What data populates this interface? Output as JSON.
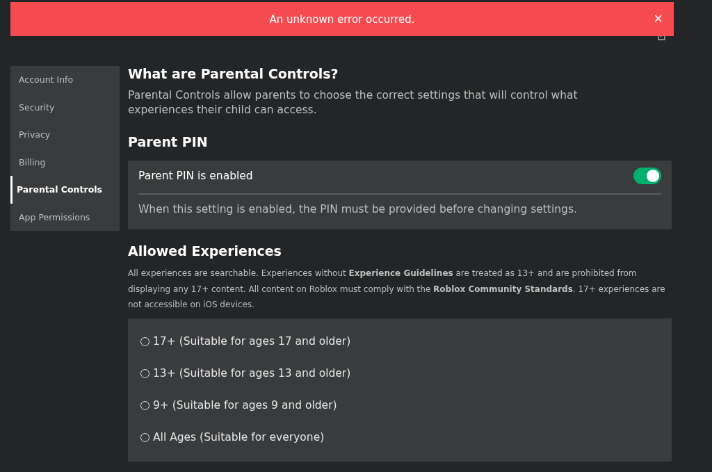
{
  "banner": {
    "message": "An unknown error occurred.",
    "close": "×"
  },
  "sidebar": {
    "items": [
      {
        "label": "Account Info",
        "selected": false
      },
      {
        "label": "Security",
        "selected": false
      },
      {
        "label": "Privacy",
        "selected": false
      },
      {
        "label": "Billing",
        "selected": false
      },
      {
        "label": "Parental Controls",
        "selected": true
      },
      {
        "label": "App Permissions",
        "selected": false
      }
    ]
  },
  "intro": {
    "heading": "What are Parental Controls?",
    "text": "Parental Controls allow parents to choose the correct settings that will control what experiences their child can access."
  },
  "parent_pin": {
    "heading": "Parent PIN",
    "label": "Parent PIN is enabled",
    "on": true,
    "description": "When this setting is enabled, the PIN must be provided before changing settings."
  },
  "allowed_experiences": {
    "heading": "Allowed Experiences",
    "text": "All experiences are searchable. Experiences without **Experience Guidelines** are treated as 13+ and are prohibited from displaying any 17+ content. All content on Roblox must comply with the **Roblox Community Standards**. 17+ experiences are not accessible on iOS devices.",
    "options": [
      {
        "label": "17+ (Suitable for ages 17 and older)",
        "selected": false
      },
      {
        "label": "13+ (Suitable for ages 13 and older)",
        "selected": false
      },
      {
        "label": "9+ (Suitable for ages 9 and older)",
        "selected": false
      },
      {
        "label": "All Ages (Suitable for everyone)",
        "selected": false
      }
    ]
  }
}
